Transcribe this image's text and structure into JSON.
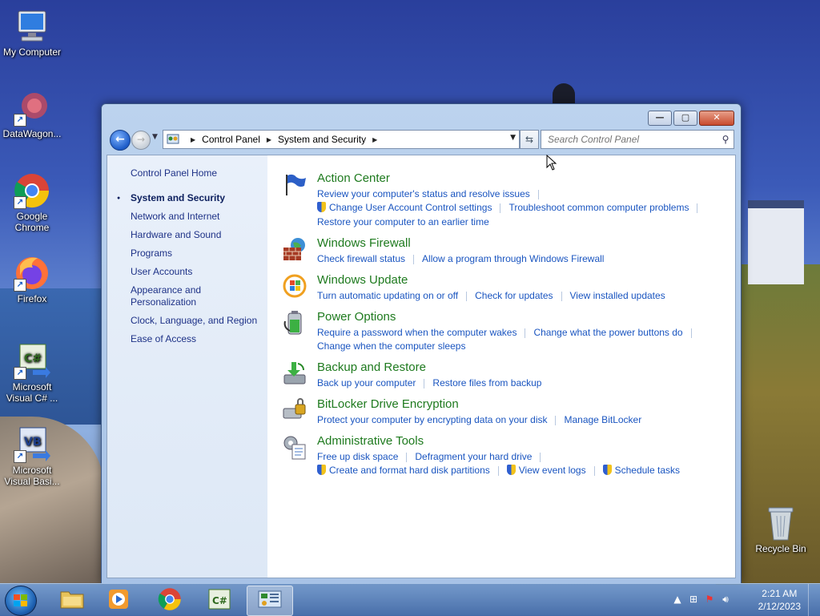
{
  "desktop": {
    "icons": [
      {
        "label": "My Computer"
      },
      {
        "label": "DataWagon..."
      },
      {
        "label": "Google Chrome"
      },
      {
        "label": "Firefox"
      },
      {
        "label": "Microsoft Visual C# ..."
      },
      {
        "label": "Microsoft Visual Basi..."
      },
      {
        "label": "Recycle Bin"
      }
    ]
  },
  "window": {
    "breadcrumb": [
      "Control Panel",
      "System and Security"
    ],
    "search_placeholder": "Search Control Panel",
    "sidebar": {
      "home": "Control Panel Home",
      "items": [
        {
          "label": "System and Security",
          "active": true
        },
        {
          "label": "Network and Internet"
        },
        {
          "label": "Hardware and Sound"
        },
        {
          "label": "Programs"
        },
        {
          "label": "User Accounts"
        },
        {
          "label": "Appearance and Personalization"
        },
        {
          "label": "Clock, Language, and Region"
        },
        {
          "label": "Ease of Access"
        }
      ]
    },
    "categories": [
      {
        "title": "Action Center",
        "icon": "flag-icon",
        "links": [
          "Review your computer's status and resolve issues",
          "Change User Account Control settings",
          "Troubleshoot common computer problems",
          "Restore your computer to an earlier time"
        ]
      },
      {
        "title": "Windows Firewall",
        "icon": "firewall-icon",
        "links": [
          "Check firewall status",
          "Allow a program through Windows Firewall"
        ]
      },
      {
        "title": "Windows Update",
        "icon": "windows-update-icon",
        "links": [
          "Turn automatic updating on or off",
          "Check for updates",
          "View installed updates"
        ]
      },
      {
        "title": "Power Options",
        "icon": "battery-icon",
        "links": [
          "Require a password when the computer wakes",
          "Change what the power buttons do",
          "Change when the computer sleeps"
        ]
      },
      {
        "title": "Backup and Restore",
        "icon": "backup-icon",
        "links": [
          "Back up your computer",
          "Restore files from backup"
        ]
      },
      {
        "title": "BitLocker Drive Encryption",
        "icon": "bitlocker-icon",
        "links": [
          "Protect your computer by encrypting data on your disk",
          "Manage BitLocker"
        ]
      },
      {
        "title": "Administrative Tools",
        "icon": "admin-tools-icon",
        "links": [
          "Free up disk space",
          "Defragment your hard drive",
          "Create and format hard disk partitions",
          "View event logs",
          "Schedule tasks"
        ]
      }
    ]
  },
  "taskbar": {
    "time": "2:21 AM",
    "date": "2/12/2023"
  }
}
